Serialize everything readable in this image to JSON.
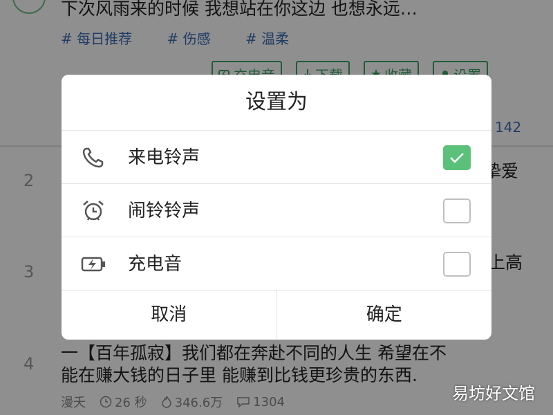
{
  "feed": {
    "item1": {
      "text": "下次风雨来的时候 我想站在你这边 也想永远…",
      "tags": [
        "# 每日推荐",
        "# 伤感",
        "# 温柔"
      ],
      "actions": [
        "充电音",
        "下载",
        "收藏",
        "设置"
      ],
      "comments": "142"
    },
    "item2": {
      "rank": "2",
      "tail": "挚爱"
    },
    "item3": {
      "rank": "3",
      "tail": "上高"
    },
    "item4": {
      "rank": "4",
      "line1": "一【百年孤寂】我们都在奔赴不同的人生 希望在不",
      "line2": "能在赚大钱的日子里 能赚到比钱更珍贵的东西.",
      "author": "漫夭",
      "duration": "26 秒",
      "likes": "346.6万",
      "comments": "1304"
    }
  },
  "dialog": {
    "title": "设置为",
    "options": [
      {
        "label": "来电铃声",
        "icon": "phone-icon",
        "checked": true
      },
      {
        "label": "闹铃铃声",
        "icon": "alarm-clock-icon",
        "checked": false
      },
      {
        "label": "充电音",
        "icon": "battery-charging-icon",
        "checked": false
      }
    ],
    "cancel": "取消",
    "confirm": "确定"
  },
  "colors": {
    "accent": "#5bc07a",
    "tag": "#3b6cb5",
    "outline": "#3aa363"
  },
  "watermark": "易坊好文馆"
}
